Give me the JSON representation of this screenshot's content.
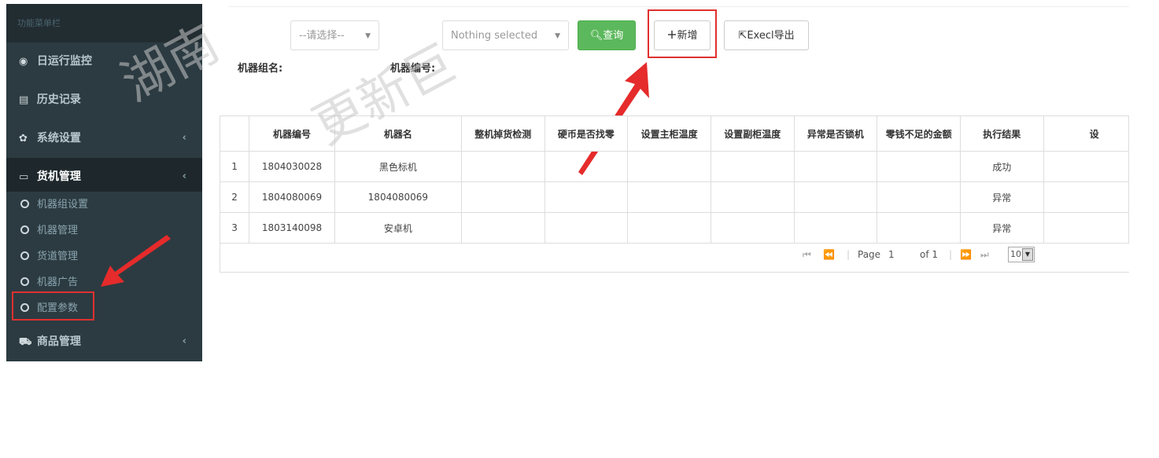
{
  "sidebar": {
    "header": "功能菜单栏",
    "items": [
      {
        "label": "日运行监控",
        "icon": "eye-icon"
      },
      {
        "label": "历史记录",
        "icon": "table-icon"
      },
      {
        "label": "系统设置",
        "icon": "gear-icon"
      },
      {
        "label": "货机管理",
        "icon": "laptop-icon"
      },
      {
        "label": "商品管理",
        "icon": "cart-icon"
      }
    ],
    "submenu": [
      "机器组设置",
      "机器管理",
      "货道管理",
      "机器广告",
      "配置参数"
    ],
    "chevron": "‹"
  },
  "toolbar": {
    "group_select_placeholder": "--请选择--",
    "machine_select_placeholder": "Nothing selected",
    "search_label": "查询",
    "add_label": "新增",
    "export_label": "Execl导出"
  },
  "filters": {
    "group_label": "机器组名:",
    "number_label": "机器编号:"
  },
  "table": {
    "headers": [
      "",
      "机器编号",
      "机器名",
      "整机掉货检测",
      "硬币是否找零",
      "设置主柜温度",
      "设置副柜温度",
      "异常是否锁机",
      "零钱不足的金额",
      "执行结果",
      "设"
    ],
    "rows": [
      [
        "1",
        "1804030028",
        "黑色标机",
        "",
        "",
        "",
        "",
        "",
        "",
        "成功",
        ""
      ],
      [
        "2",
        "1804080069",
        "1804080069",
        "",
        "",
        "",
        "",
        "",
        "",
        "异常",
        ""
      ],
      [
        "3",
        "1803140098",
        "安卓机",
        "",
        "",
        "",
        "",
        "",
        "",
        "异常",
        ""
      ]
    ]
  },
  "pagination": {
    "page_label": "Page",
    "page_value": "1",
    "of_label": "of 1",
    "page_size": "10"
  },
  "watermark": [
    "湖南",
    "更新巨"
  ],
  "colors": {
    "sidebar_bg": "#2c3b41",
    "search_green": "#5cb85c",
    "highlight_red": "#e03030"
  }
}
